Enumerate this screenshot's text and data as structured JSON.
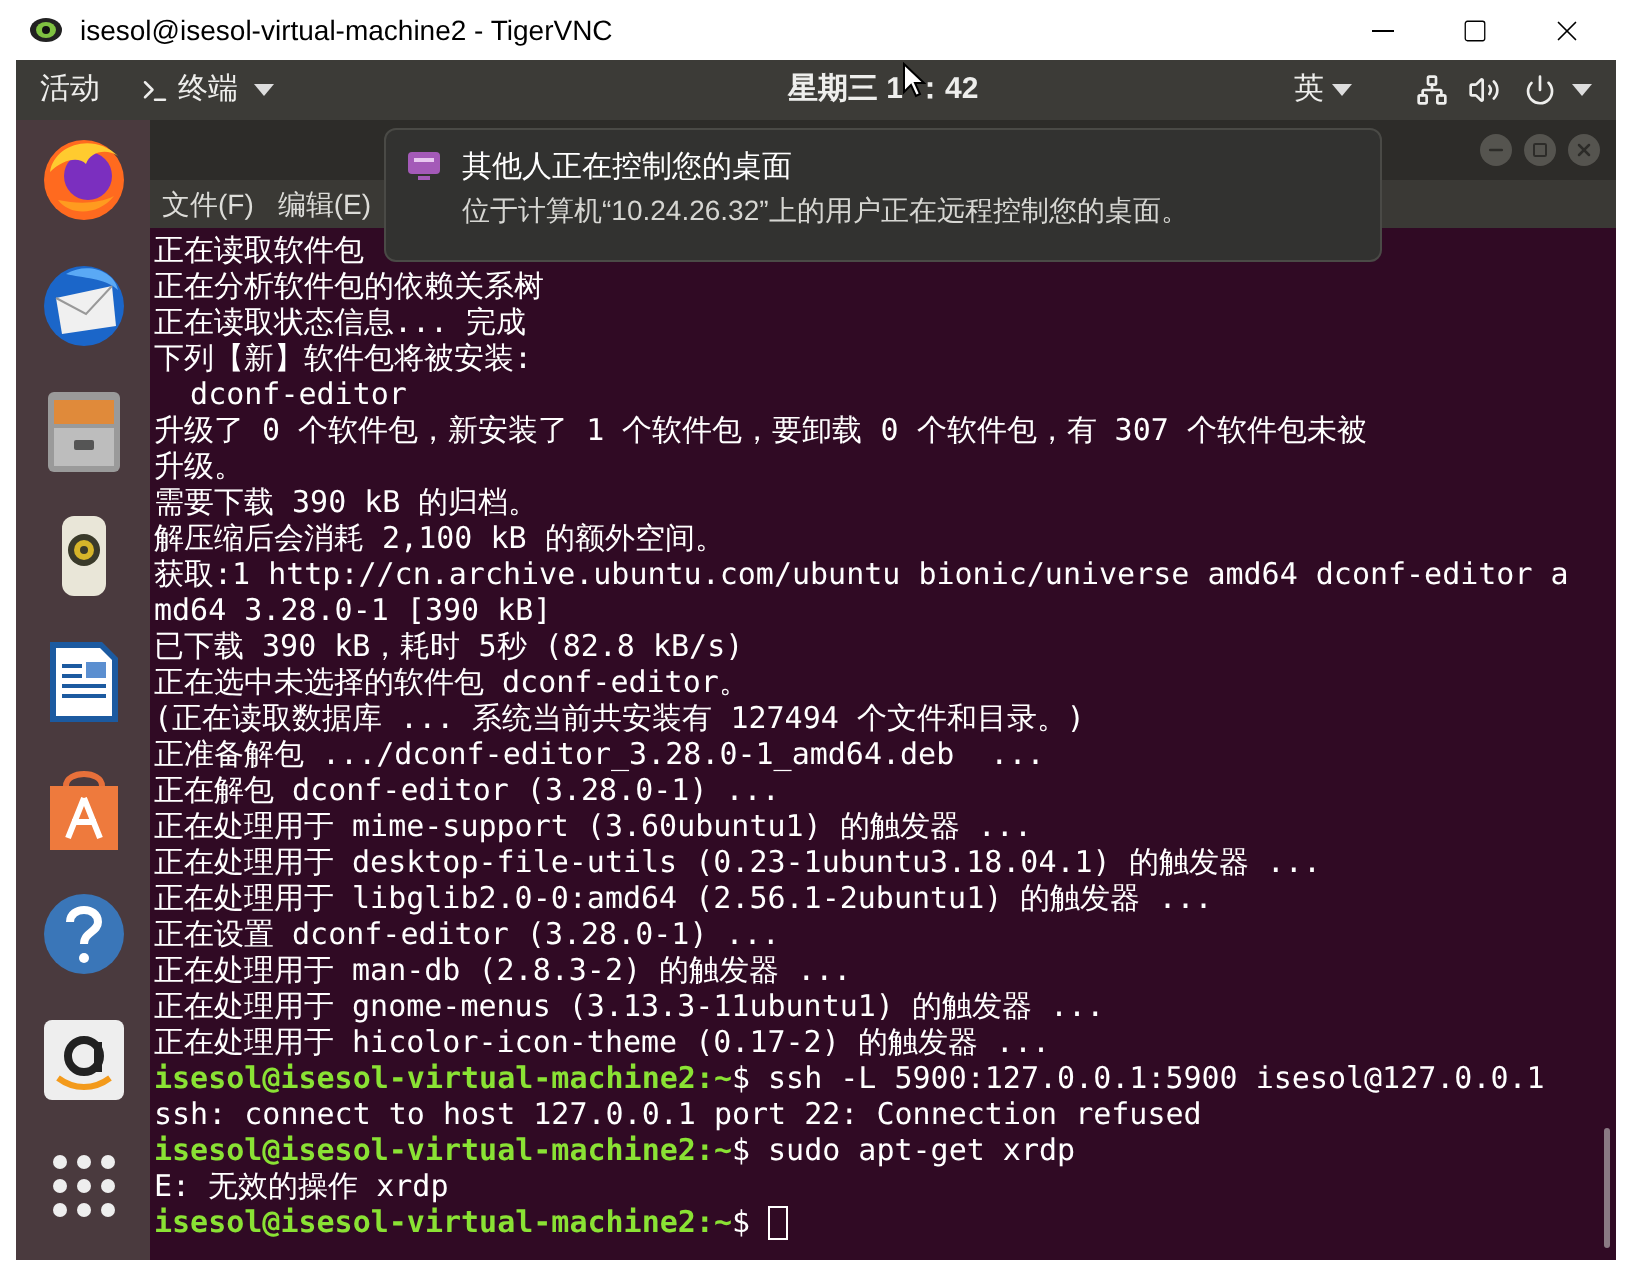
{
  "window": {
    "title": "isesol@isesol-virtual-machine2 - TigerVNC"
  },
  "top_bar": {
    "activities": "活动",
    "app_menu": "终端",
    "clock_start": "星期三 1",
    "clock_end": "：42",
    "input_method": "英"
  },
  "notification": {
    "title": "其他人正在控制您的桌面",
    "body": "位于计算机“10.24.26.32”上的用户正在远程控制您的桌面。"
  },
  "terminal": {
    "menu": [
      "文件(F)",
      "编辑(E)"
    ],
    "lines": [
      {
        "kind": "output",
        "text": "正在读取软件包"
      },
      {
        "kind": "output",
        "text": "正在分析软件包的依赖关系树"
      },
      {
        "kind": "output",
        "text": "正在读取状态信息... 完成"
      },
      {
        "kind": "output",
        "text": "下列【新】软件包将被安装:"
      },
      {
        "kind": "output",
        "text": "  dconf-editor"
      },
      {
        "kind": "output",
        "text": "升级了 0 个软件包，新安装了 1 个软件包，要卸载 0 个软件包，有 307 个软件包未被"
      },
      {
        "kind": "output",
        "text": "升级。"
      },
      {
        "kind": "output",
        "text": "需要下载 390 kB 的归档。"
      },
      {
        "kind": "output",
        "text": "解压缩后会消耗 2,100 kB 的额外空间。"
      },
      {
        "kind": "output",
        "text": "获取:1 http://cn.archive.ubuntu.com/ubuntu bionic/universe amd64 dconf-editor a"
      },
      {
        "kind": "output",
        "text": "md64 3.28.0-1 [390 kB]"
      },
      {
        "kind": "output",
        "text": "已下载 390 kB，耗时 5秒 (82.8 kB/s)"
      },
      {
        "kind": "output",
        "text": "正在选中未选择的软件包 dconf-editor。"
      },
      {
        "kind": "output",
        "text": "(正在读取数据库 ... 系统当前共安装有 127494 个文件和目录。)"
      },
      {
        "kind": "output",
        "text": "正准备解包 .../dconf-editor_3.28.0-1_amd64.deb  ..."
      },
      {
        "kind": "output",
        "text": "正在解包 dconf-editor (3.28.0-1) ..."
      },
      {
        "kind": "output",
        "text": "正在处理用于 mime-support (3.60ubuntu1) 的触发器 ..."
      },
      {
        "kind": "output",
        "text": "正在处理用于 desktop-file-utils (0.23-1ubuntu3.18.04.1) 的触发器 ..."
      },
      {
        "kind": "output",
        "text": "正在处理用于 libglib2.0-0:amd64 (2.56.1-2ubuntu1) 的触发器 ..."
      },
      {
        "kind": "output",
        "text": "正在设置 dconf-editor (3.28.0-1) ..."
      },
      {
        "kind": "output",
        "text": "正在处理用于 man-db (2.8.3-2) 的触发器 ..."
      },
      {
        "kind": "output",
        "text": "正在处理用于 gnome-menus (3.13.3-11ubuntu1) 的触发器 ..."
      },
      {
        "kind": "output",
        "text": "正在处理用于 hicolor-icon-theme (0.17-2) 的触发器 ..."
      },
      {
        "kind": "prompt",
        "user": "isesol@isesol-virtual-machine2:~",
        "symbol": "$",
        "command": "ssh -L 5900:127.0.0.1:5900 isesol@127.0.0.1"
      },
      {
        "kind": "output",
        "text": "ssh: connect to host 127.0.0.1 port 22: Connection refused"
      },
      {
        "kind": "prompt",
        "user": "isesol@isesol-virtual-machine2:~",
        "symbol": "$",
        "command": "sudo apt-get xrdp"
      },
      {
        "kind": "output",
        "text": "E: 无效的操作 xrdp"
      },
      {
        "kind": "prompt",
        "user": "isesol@isesol-virtual-machine2:~",
        "symbol": "$",
        "cursor": true
      }
    ]
  }
}
